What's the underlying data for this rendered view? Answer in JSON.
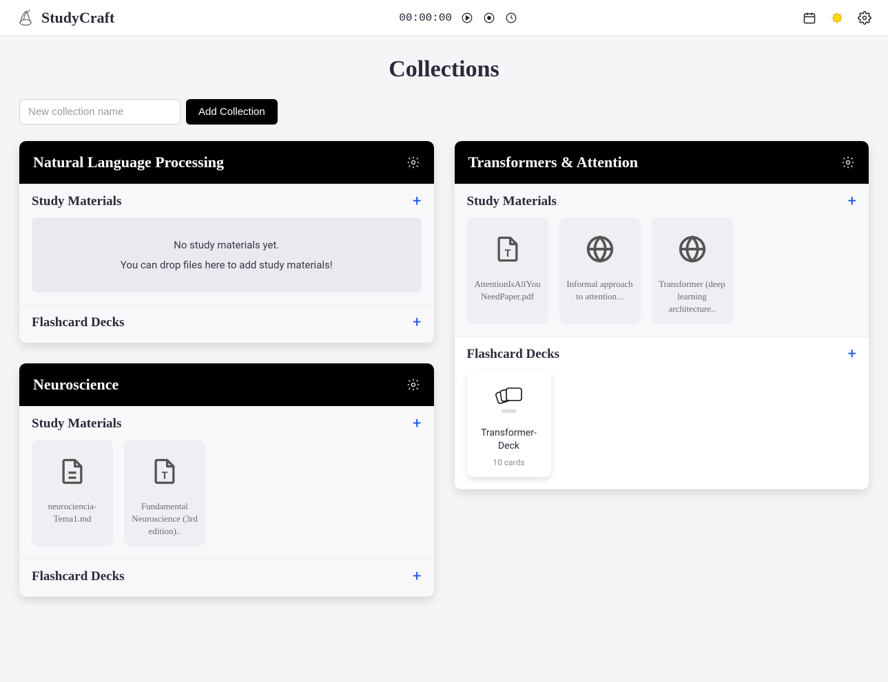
{
  "header": {
    "brand": "StudyCraft",
    "timer": "00:00:00"
  },
  "page": {
    "title": "Collections"
  },
  "add": {
    "placeholder": "New collection name",
    "button": "Add Collection"
  },
  "labels": {
    "study_materials": "Study Materials",
    "flashcard_decks": "Flashcard Decks",
    "empty1": "No study materials yet.",
    "empty2": "You can drop files here to add study materials!"
  },
  "collections": {
    "nlp": {
      "title": "Natural Language Processing"
    },
    "neuro": {
      "title": "Neuroscience",
      "materials": [
        {
          "name": "neurociencia-Tema1.md",
          "type": "doc"
        },
        {
          "name": "Fundamental Neuroscience (3rd edition)..",
          "type": "text"
        }
      ]
    },
    "transformers": {
      "title": "Transformers & Attention",
      "materials": [
        {
          "name": "AttentionIsAllYouNeedPaper.pdf",
          "type": "text"
        },
        {
          "name": "Informal approach to attention...",
          "type": "web"
        },
        {
          "name": "Transformer (deep learning architecture..",
          "type": "web"
        }
      ],
      "decks": [
        {
          "name": "Transformer-Deck",
          "count": "10 cards"
        }
      ]
    }
  }
}
